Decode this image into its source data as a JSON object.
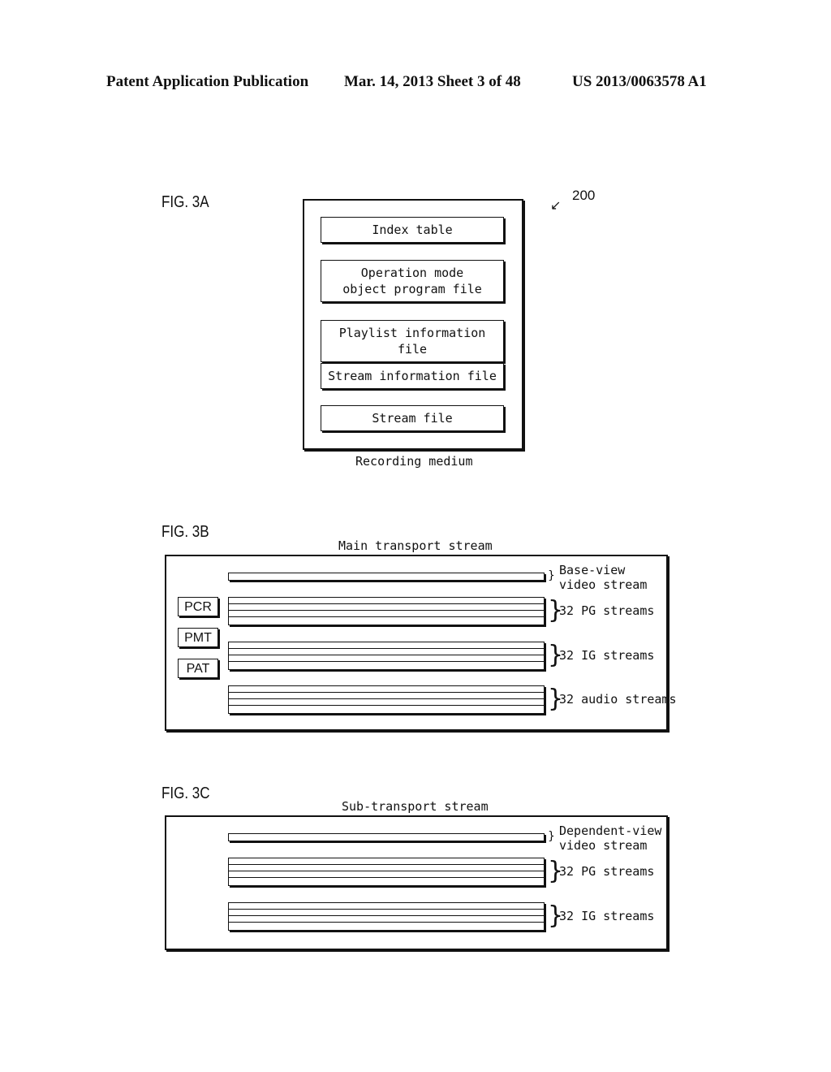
{
  "header": {
    "left": "Patent Application Publication",
    "center": "Mar. 14, 2013  Sheet 3 of 48",
    "right": "US 2013/0063578 A1"
  },
  "fig3a": {
    "label": "FIG. 3A",
    "ref": "200",
    "caption": "Recording medium",
    "items": [
      "Index table",
      "Operation mode\nobject program file",
      "Playlist information file",
      "Stream information file",
      "Stream file"
    ]
  },
  "fig3b": {
    "label": "FIG. 3B",
    "title": "Main transport stream",
    "tags": [
      "PCR",
      "PMT",
      "PAT"
    ],
    "streams": [
      "Base-view\nvideo stream",
      "32 PG streams",
      "32 IG streams",
      "32 audio streams"
    ]
  },
  "fig3c": {
    "label": "FIG. 3C",
    "title": "Sub-transport stream",
    "streams": [
      "Dependent-view\nvideo stream",
      "32 PG streams",
      "32 IG streams"
    ]
  }
}
